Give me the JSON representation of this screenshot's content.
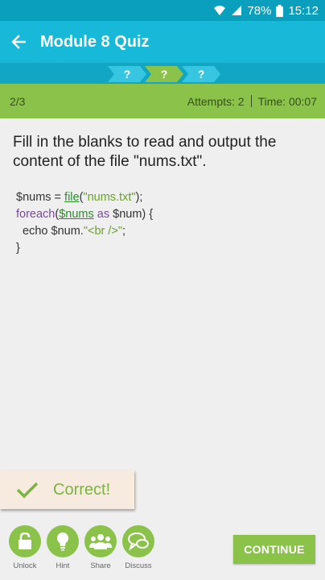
{
  "status_bar": {
    "battery": "78%",
    "time": "15:12"
  },
  "header": {
    "title": "Module 8 Quiz"
  },
  "progress": {
    "steps": [
      "?",
      "?",
      "?"
    ]
  },
  "info": {
    "position": "2/3",
    "attempts": "Attempts: 2",
    "time": "Time: 00:07"
  },
  "question": {
    "text": "Fill in the blanks to read and output the content of the file \"nums.txt\"."
  },
  "code": {
    "l1_var": "$nums = ",
    "l1_fn": "file",
    "l1_open": "(",
    "l1_str": "\"nums.txt\"",
    "l1_close": ");",
    "l2_kw": "foreach",
    "l2_open": "(",
    "l2_blank": "$nums",
    "l2_as": " as ",
    "l2_rest": "$num) {",
    "l3_pre": "  echo $num.",
    "l3_str": "\"<br />\"",
    "l3_end": ";",
    "l4": "}"
  },
  "toast": {
    "text": "Correct!"
  },
  "actions": [
    {
      "label": "Unlock",
      "icon": "lock-icon"
    },
    {
      "label": "Hint",
      "icon": "lightbulb-icon"
    },
    {
      "label": "Share",
      "icon": "people-icon"
    },
    {
      "label": "Discuss",
      "icon": "chat-icon"
    }
  ],
  "continue_label": "CONTINUE",
  "colors": {
    "primary": "#18b8d8",
    "primary_dark": "#0a9fbc",
    "accent": "#8bc34a",
    "toast_bg": "#f7ebe0"
  }
}
